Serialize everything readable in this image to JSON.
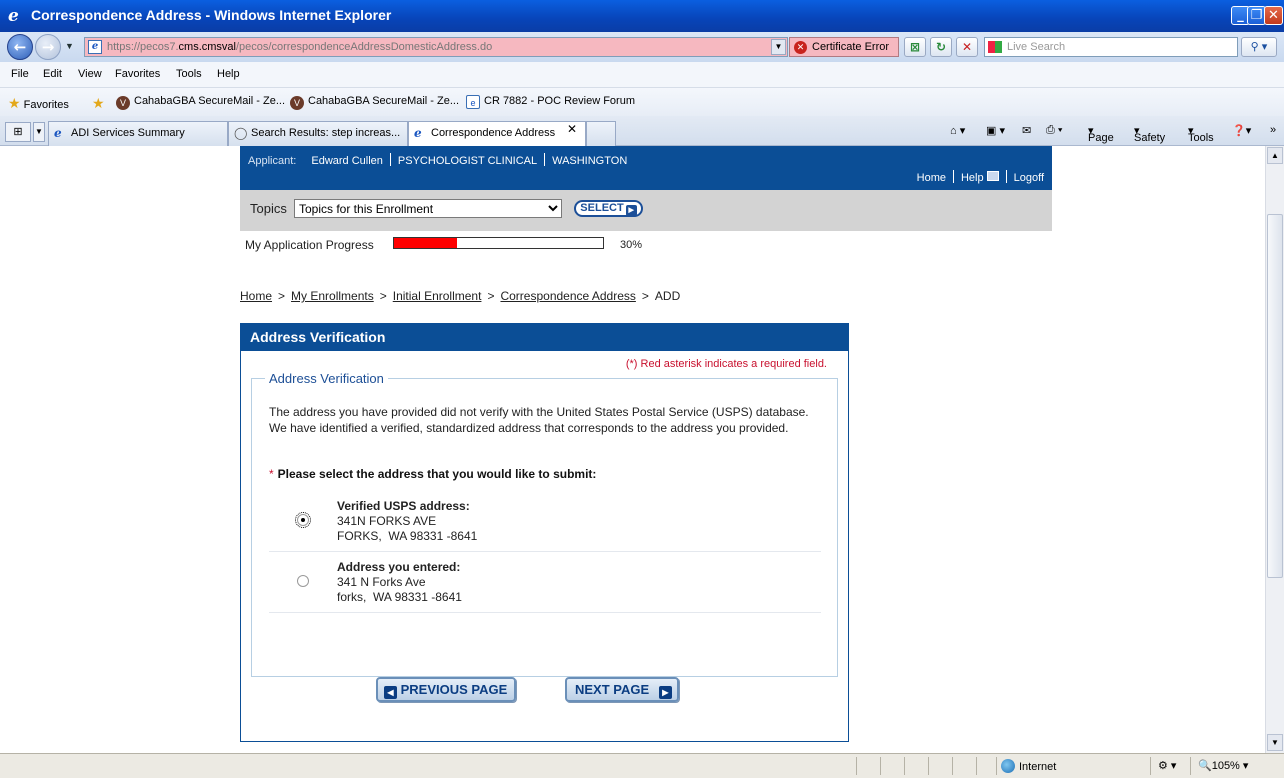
{
  "window": {
    "title": "Correspondence Address - Windows Internet Explorer",
    "minimize": "_",
    "restore": "❐",
    "close": "✕"
  },
  "address_bar": {
    "url_prefix": "https://pecos7.",
    "url_host": "cms.cmsval",
    "url_path": "/pecos/correspondenceAddressDomesticAddress.do",
    "certificate_error": "Certificate Error",
    "search_placeholder": "Live Search"
  },
  "menu": [
    "File",
    "Edit",
    "View",
    "Favorites",
    "Tools",
    "Help"
  ],
  "favorites_bar": {
    "favorites_label": "Favorites",
    "items": [
      "CahabaGBA SecureMail - Ze...",
      "CahabaGBA SecureMail - Ze...",
      "CR 7882 - POC Review Forum"
    ]
  },
  "tabs": [
    {
      "label": "ADI Services Summary",
      "active": false
    },
    {
      "label": "Search Results: step increas...",
      "active": false
    },
    {
      "label": "Correspondence Address",
      "active": true
    }
  ],
  "command_bar": {
    "page": "Page",
    "safety": "Safety",
    "tools": "Tools"
  },
  "app_header": {
    "applicant_label": "Applicant:",
    "applicant_name": "Edward Cullen",
    "applicant_type": "PSYCHOLOGIST CLINICAL",
    "state": "WASHINGTON",
    "links": {
      "home": "Home",
      "help": "Help",
      "logoff": "Logoff"
    }
  },
  "topics": {
    "label": "Topics",
    "selected": "Topics for this Enrollment",
    "button": "SELECT"
  },
  "progress": {
    "label": "My Application Progress",
    "percent_text": "30%",
    "value": 0.3,
    "fill_color": "#ff0000"
  },
  "breadcrumb": {
    "items": [
      "Home",
      "My Enrollments",
      "Initial Enrollment",
      "Correspondence Address"
    ],
    "current": "ADD",
    "separator": ">"
  },
  "panel": {
    "title": "Address Verification",
    "required_note": "(*) Red asterisk indicates a required field.",
    "fieldset_legend": "Address Verification",
    "description": "The address you have provided did not verify with the United States Postal Service (USPS) database. We have identified a verified, standardized address that corresponds to the address you provided.",
    "prompt_asterisk": "*",
    "prompt": "Please select the address that you would like to submit:",
    "options": [
      {
        "label": "Verified USPS address:",
        "line1": "341N FORKS AVE",
        "line2": "FORKS,  WA 98331 -8641",
        "selected": true
      },
      {
        "label": "Address you entered:",
        "line1": "341 N Forks Ave",
        "line2": "forks,  WA 98331 -8641",
        "selected": false
      }
    ],
    "prev_button": "PREVIOUS PAGE",
    "next_button": "NEXT PAGE"
  },
  "status_bar": {
    "zone": "Internet",
    "zoom": "105%"
  },
  "colors": {
    "brand_blue": "#0b4e96",
    "required_red": "#c8102e",
    "cert_error_bg": "#f6b8c0"
  }
}
